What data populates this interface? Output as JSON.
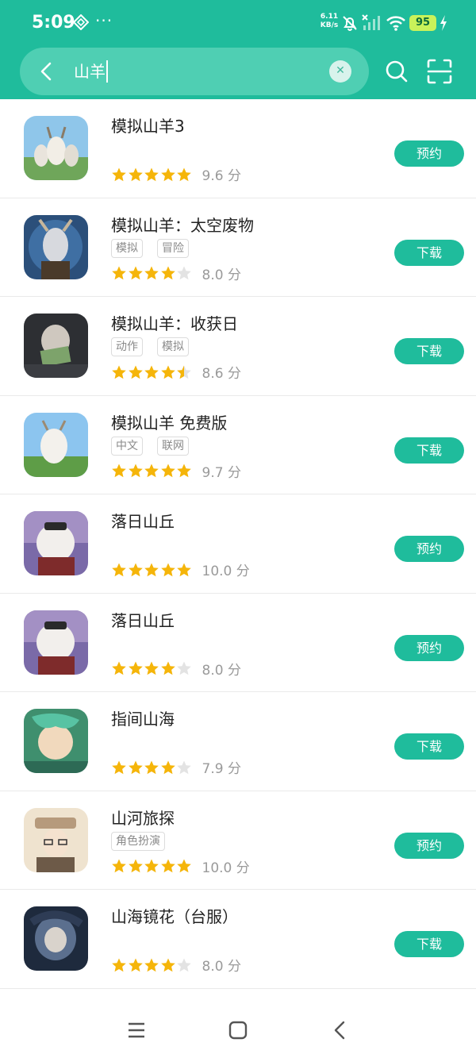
{
  "status_bar": {
    "time": "5:09",
    "network_speed_value": "6.11",
    "network_speed_unit": "KB/s",
    "battery": "95"
  },
  "search": {
    "query": "山羊"
  },
  "results": [
    {
      "name": "模拟山羊3",
      "tags": [],
      "stars": 5,
      "score": "9.6 分",
      "action": "预约",
      "icon": "goat-sim-3-icon"
    },
    {
      "name": "模拟山羊：太空废物",
      "tags": [
        "模拟",
        "冒险"
      ],
      "stars": 4,
      "score": "8.0 分",
      "action": "下载",
      "icon": "goat-space-icon"
    },
    {
      "name": "模拟山羊：收获日",
      "tags": [
        "动作",
        "模拟"
      ],
      "stars": 4.5,
      "score": "8.6 分",
      "action": "下载",
      "icon": "goat-payday-icon"
    },
    {
      "name": "模拟山羊 免费版",
      "tags": [
        "中文",
        "联网"
      ],
      "stars": 5,
      "score": "9.7 分",
      "action": "下载",
      "icon": "goat-free-icon"
    },
    {
      "name": "落日山丘",
      "tags": [],
      "stars": 5,
      "score": "10.0 分",
      "action": "预约",
      "icon": "sunset-hills-icon"
    },
    {
      "name": "落日山丘",
      "tags": [],
      "stars": 4,
      "score": "8.0 分",
      "action": "预约",
      "icon": "sunset-hills-icon"
    },
    {
      "name": "指间山海",
      "tags": [],
      "stars": 4,
      "score": "7.9 分",
      "action": "下载",
      "icon": "fingertip-mountains-icon"
    },
    {
      "name": "山河旅探",
      "tags": [
        "角色扮演"
      ],
      "stars": 5,
      "score": "10.0 分",
      "action": "预约",
      "icon": "detective-icon"
    },
    {
      "name": "山海镜花（台服）",
      "tags": [],
      "stars": 4,
      "score": "8.0 分",
      "action": "下载",
      "icon": "mirror-flower-icon"
    }
  ],
  "colors": {
    "accent": "#1fbc9c",
    "star_filled": "#f5b50a",
    "star_empty": "#e3e3e3"
  }
}
